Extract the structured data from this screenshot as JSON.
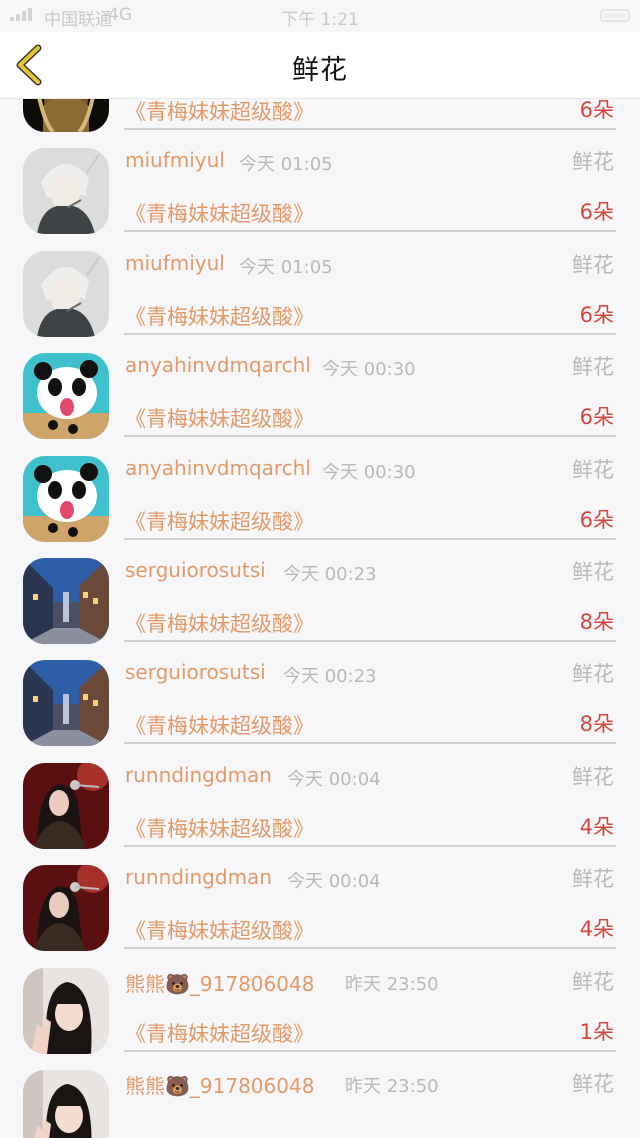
{
  "status_bar": {
    "carrier": "中国联通",
    "network": "4G",
    "time": "下午 1:21"
  },
  "header": {
    "title": "鲜花",
    "back_icon": "chevron-left-icon",
    "accent_color": "#e6c531"
  },
  "rows": [
    {
      "user": "",
      "date": "",
      "kind": "",
      "book": "《青梅妹妹超级酸》",
      "count": "6朵",
      "avatar": "golden-statue-avatar"
    },
    {
      "user": "miufmiyul",
      "date": "今天 01:05",
      "kind": "鲜花",
      "book": "《青梅妹妹超级酸》",
      "count": "6朵",
      "avatar": "anime-white-hair-avatar"
    },
    {
      "user": "miufmiyul",
      "date": "今天 01:05",
      "kind": "鲜花",
      "book": "《青梅妹妹超级酸》",
      "count": "6朵",
      "avatar": "anime-white-hair-avatar"
    },
    {
      "user": "anyahinvdmqarchl",
      "date": "今天 00:30",
      "kind": "鲜花",
      "book": "《青梅妹妹超级酸》",
      "count": "6朵",
      "avatar": "panda-avatar"
    },
    {
      "user": "anyahinvdmqarchl",
      "date": "今天 00:30",
      "kind": "鲜花",
      "book": "《青梅妹妹超级酸》",
      "count": "6朵",
      "avatar": "panda-avatar"
    },
    {
      "user": "serguiorosutsi",
      "date": "今天 00:23",
      "kind": "鲜花",
      "book": "《青梅妹妹超级酸》",
      "count": "8朵",
      "avatar": "city-street-avatar"
    },
    {
      "user": "serguiorosutsi",
      "date": "今天 00:23",
      "kind": "鲜花",
      "book": "《青梅妹妹超级酸》",
      "count": "8朵",
      "avatar": "city-street-avatar"
    },
    {
      "user": "runndingdman",
      "date": "今天 00:04",
      "kind": "鲜花",
      "book": "《青梅妹妹超级酸》",
      "count": "4朵",
      "avatar": "singer-microphone-avatar"
    },
    {
      "user": "runndingdman",
      "date": "今天 00:04",
      "kind": "鲜花",
      "book": "《青梅妹妹超级酸》",
      "count": "4朵",
      "avatar": "singer-microphone-avatar"
    },
    {
      "user": "熊熊🐻_917806048",
      "date": "昨天 23:50",
      "kind": "鲜花",
      "book": "《青梅妹妹超级酸》",
      "count": "1朵",
      "avatar": "girl-peace-sign-avatar"
    },
    {
      "user": "熊熊🐻_917806048",
      "date": "昨天 23:50",
      "kind": "鲜花",
      "book": "",
      "count": "",
      "avatar": "girl-peace-sign-avatar"
    }
  ]
}
